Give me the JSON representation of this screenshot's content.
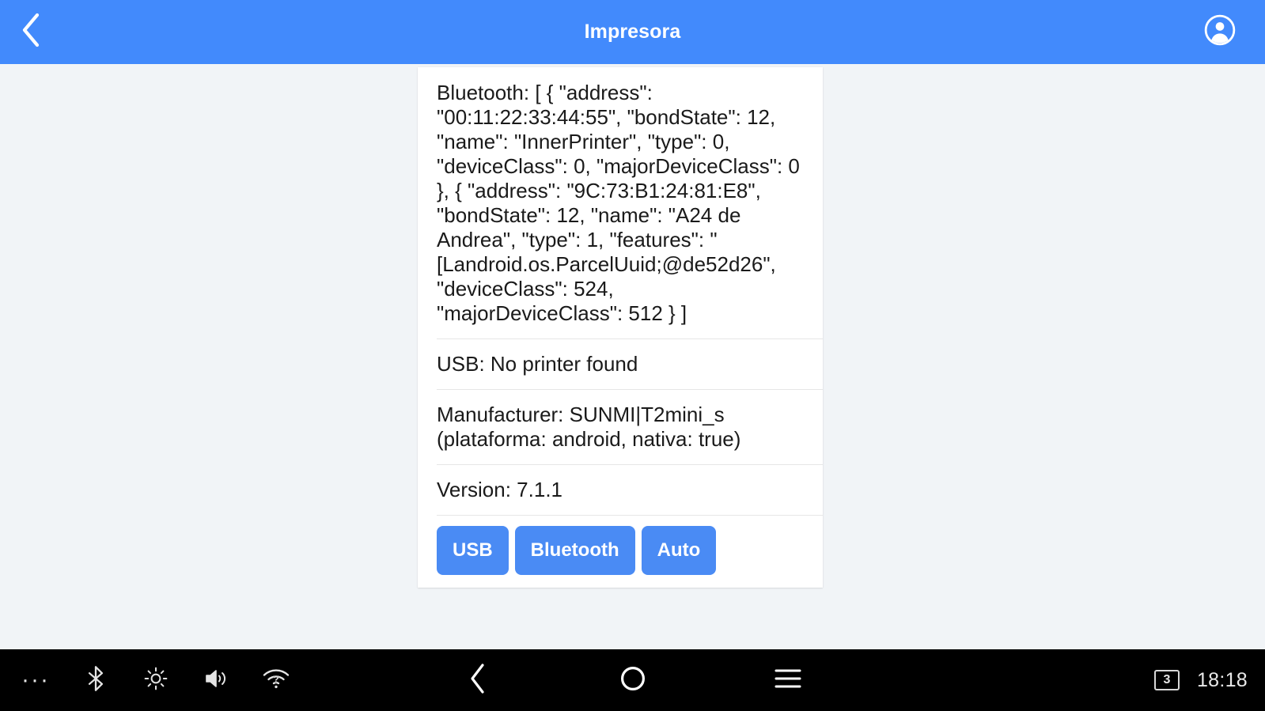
{
  "appbar": {
    "title": "Impresora",
    "back_icon": "chevron-left-icon",
    "account_icon": "account-circle-icon",
    "background_color": "#428afc"
  },
  "card": {
    "items": [
      {
        "name": "bluetooth-info",
        "text": "Bluetooth: [ { \"address\": \"00:11:22:33:44:55\", \"bondState\": 12, \"name\": \"InnerPrinter\", \"type\": 0, \"deviceClass\": 0, \"majorDeviceClass\": 0 }, { \"address\": \"9C:73:B1:24:81:E8\", \"bondState\": 12, \"name\": \"A24 de Andrea\", \"type\": 1, \"features\": \" [Landroid.os.ParcelUuid;@de52d26\", \"deviceClass\": 524, \"majorDeviceClass\": 512 } ]"
      },
      {
        "name": "usb-info",
        "text": "USB: No printer found"
      },
      {
        "name": "manufacturer-info",
        "text": "Manufacturer: SUNMI|T2mini_s (plataforma: android, nativa: true)"
      },
      {
        "name": "version-info",
        "text": "Version: 7.1.1"
      }
    ],
    "buttons": [
      {
        "name": "usb-button",
        "label": "USB"
      },
      {
        "name": "bluetooth-button",
        "label": "Bluetooth"
      },
      {
        "name": "auto-button",
        "label": "Auto"
      }
    ],
    "button_color": "#4a8bf4"
  },
  "navbar": {
    "tray": [
      {
        "name": "more-icon",
        "glyph": "···"
      },
      {
        "name": "bluetooth-icon"
      },
      {
        "name": "brightness-icon"
      },
      {
        "name": "volume-icon"
      },
      {
        "name": "wifi-no-internet-icon"
      }
    ],
    "back_icon": "back-chevron-icon",
    "home_icon": "home-circle-icon",
    "recents_icon": "recents-menu-icon",
    "notification_count": "3",
    "clock": "18:18",
    "background_color": "#000000"
  }
}
